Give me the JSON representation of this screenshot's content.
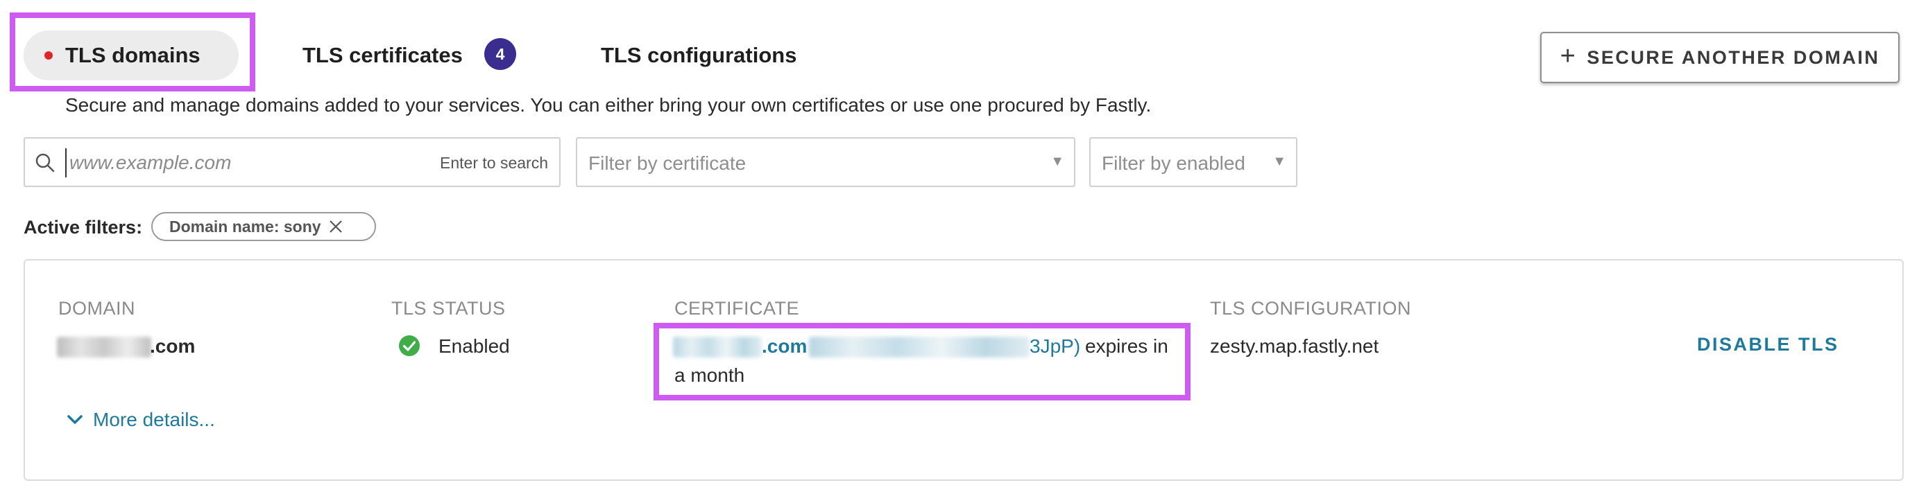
{
  "tabs": [
    {
      "label": "TLS domains",
      "active": true
    },
    {
      "label": "TLS certificates",
      "badge": "4"
    },
    {
      "label": "TLS configurations"
    }
  ],
  "header": {
    "secure_button_label": "SECURE ANOTHER DOMAIN",
    "intro": "Secure and manage domains added to your services. You can either bring your own certificates or use one procured by Fastly."
  },
  "filters": {
    "search_placeholder": "www.example.com",
    "search_hint": "Enter to search",
    "certificate_placeholder": "Filter by certificate",
    "enabled_placeholder": "Filter by enabled",
    "active_label": "Active filters:",
    "chip_label": "Domain name: sony"
  },
  "table": {
    "columns": [
      "DOMAIN",
      "TLS STATUS",
      "CERTIFICATE",
      "TLS CONFIGURATION"
    ],
    "row": {
      "domain_suffix": ".com",
      "status": "Enabled",
      "cert_name_suffix": ".com",
      "cert_id_suffix": "3JpP)",
      "cert_expiry_part1": "expires in",
      "cert_expiry_part2": "a month",
      "configuration": "zesty.map.fastly.net",
      "action": "DISABLE TLS",
      "more_details": "More details..."
    }
  },
  "colors": {
    "accent_link": "#1e7a9d",
    "badge": "#3b2d8f",
    "status_ok": "#3fae49",
    "active_dot": "#e0252b",
    "highlight": "#cf5cf0"
  }
}
